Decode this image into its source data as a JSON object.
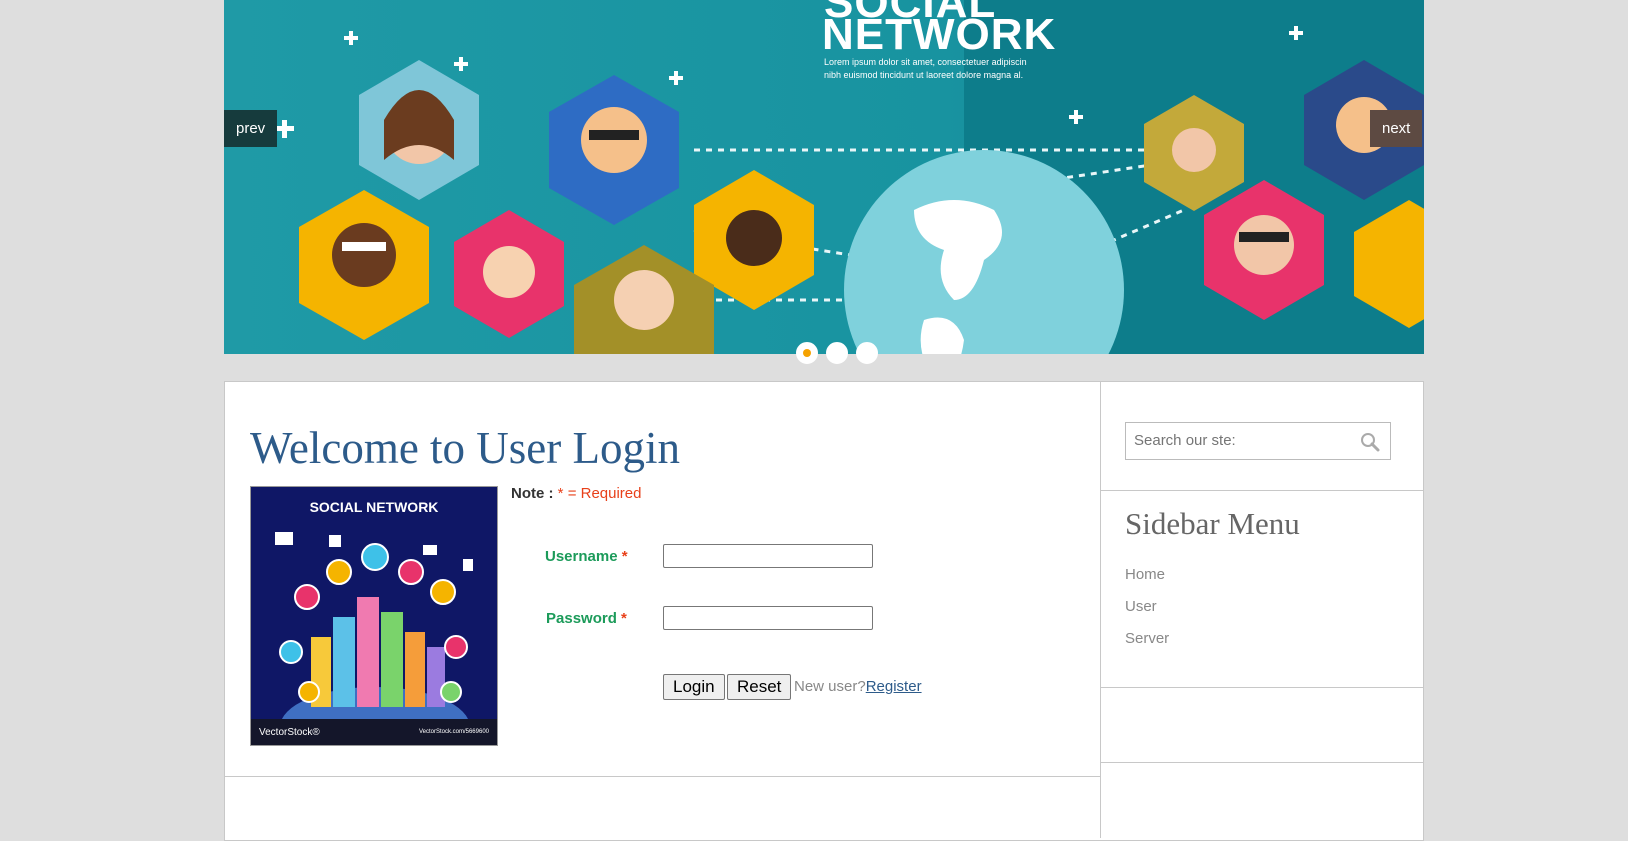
{
  "slider": {
    "heading": "NETWORK",
    "heading_top": "SOCIAL",
    "tagline_1": "Lorem ipsum dolor sit amet, consectetuer adipiscin",
    "tagline_2": "nibh euismod tincidunt ut laoreet dolore magna al.",
    "prev_label": "prev",
    "next_label": "next",
    "slide_count": 3,
    "active_slide": 1
  },
  "main": {
    "title": "Welcome to User Login",
    "poster": {
      "title": "SOCIAL NETWORK",
      "brand": "VectorStock®",
      "url": "VectorStock.com/5669600"
    },
    "note": {
      "label": "Note :",
      "asterisk": "*",
      "text": "= Required"
    },
    "form": {
      "username_label": "Username",
      "password_label": "Password",
      "required_mark": "*",
      "username_value": "",
      "password_value": "",
      "login_label": "Login",
      "reset_label": "Reset",
      "new_user_text": "New user?",
      "register_label": "Register"
    }
  },
  "sidebar": {
    "search_placeholder": "Search our ste:",
    "menu_title": "Sidebar Menu",
    "menu_items": [
      "Home",
      "User",
      "Server"
    ]
  },
  "colors": {
    "page_bg": "#dedede",
    "title_blue": "#2d5b8a",
    "label_green": "#1c9b5a",
    "required_red": "#e8401a",
    "active_dot": "#f5a200"
  }
}
